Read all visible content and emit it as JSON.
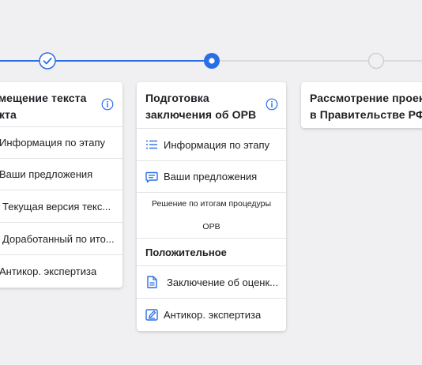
{
  "colors": {
    "accent": "#2a6ee6",
    "line_inactive": "#d4d4d8",
    "step_inactive": "#d0d0d4"
  },
  "steps": [
    {
      "state": "completed",
      "icon": "check-icon"
    },
    {
      "state": "current",
      "icon": "dot-icon"
    },
    {
      "state": "upcoming",
      "icon": "circle-icon"
    }
  ],
  "card1": {
    "title_line1": "змещение текста",
    "title_line2": "екта",
    "items": [
      {
        "label": "Информация по этапу"
      },
      {
        "label": "Ваши предложения"
      },
      {
        "label": "Текущая версия текс..."
      },
      {
        "label": "Доработанный по ито..."
      },
      {
        "label": "Антикор. экспертиза"
      }
    ]
  },
  "card2": {
    "title_line1": "Подготовка",
    "title_line2": "заключения об ОРВ",
    "items": [
      {
        "label": "Информация по этапу",
        "icon": "list-icon"
      },
      {
        "label": "Ваши предложения",
        "icon": "comment-icon"
      }
    ],
    "decision_caption_line1": "Решение по итогам процедуры",
    "decision_caption_line2": "ОРВ",
    "decision": "Положительное",
    "docs": [
      {
        "label": "Заключение об оценк...",
        "icon": "document-icon"
      },
      {
        "label": "Антикор. экспертиза",
        "icon": "edit-document-icon"
      }
    ]
  },
  "card3": {
    "title_line1": "Рассмотрение проекта",
    "title_line2": "в Правительстве РФ"
  }
}
